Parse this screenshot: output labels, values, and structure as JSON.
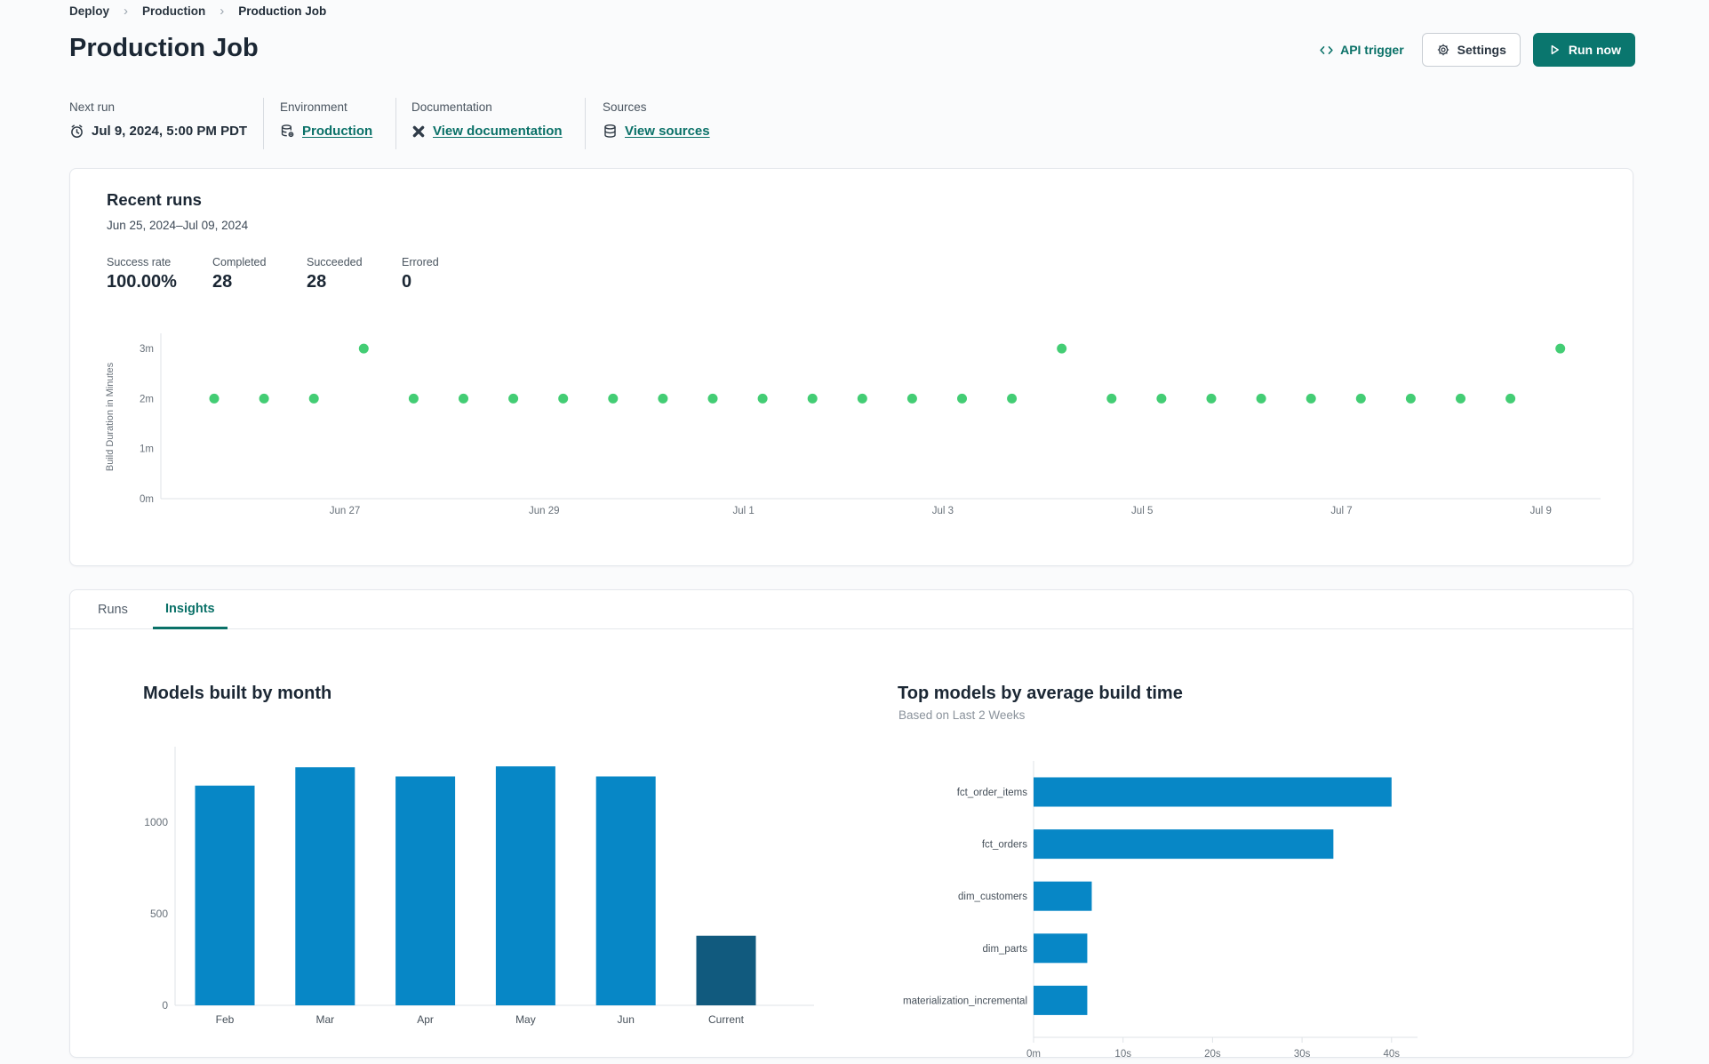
{
  "icons": {
    "breadcrumb_separator": "›"
  },
  "breadcrumb": [
    "Deploy",
    "Production",
    "Production Job"
  ],
  "header": {
    "title": "Production Job",
    "api_trigger_label": "API trigger",
    "settings_label": "Settings",
    "run_now_label": "Run now"
  },
  "meta": {
    "next_run": {
      "label": "Next run",
      "value": "Jul 9, 2024, 5:00 PM PDT"
    },
    "environment": {
      "label": "Environment",
      "link": "Production"
    },
    "documentation": {
      "label": "Documentation",
      "link": "View documentation"
    },
    "sources": {
      "label": "Sources",
      "link": "View sources"
    }
  },
  "recent_runs": {
    "title": "Recent runs",
    "date_range": "Jun 25, 2024–Jul 09, 2024",
    "stats": [
      {
        "label": "Success rate",
        "value": "100.00%"
      },
      {
        "label": "Completed",
        "value": "28"
      },
      {
        "label": "Succeeded",
        "value": "28"
      },
      {
        "label": "Errored",
        "value": "0"
      }
    ]
  },
  "tabs": [
    {
      "label": "Runs",
      "active": false
    },
    {
      "label": "Insights",
      "active": true
    }
  ],
  "colors": {
    "accent": "#0a7168",
    "run_now_bg": "#0a766e",
    "dot_green": "#43cd74",
    "bar_blue": "#0787c6",
    "bar_navy": "#115a7e",
    "axis_line": "#dfe3e7",
    "tick_text": "#68717a",
    "tick_text_dark": "#454f59"
  },
  "chart_data": [
    {
      "type": "scatter",
      "ylabel": "Build Duration in Minutes",
      "y_ticks": [
        "0m",
        "1m",
        "2m",
        "3m"
      ],
      "x_tick_labels": [
        "Jun 27",
        "Jun 29",
        "Jul 1",
        "Jul 3",
        "Jul 5",
        "Jul 7",
        "Jul 9"
      ],
      "x_range": [
        "Jun 25, 2024",
        "Jul 09, 2024"
      ],
      "ylim_minutes": [
        0,
        3.3
      ],
      "points_minutes": [
        2,
        2,
        2,
        3,
        2,
        2,
        2,
        2,
        2,
        2,
        2,
        2,
        2,
        2,
        2,
        2,
        2,
        3,
        2,
        2,
        2,
        2,
        2,
        2,
        2,
        2,
        2,
        3
      ],
      "point_color": "#43cd74",
      "grid": false,
      "legend": "none"
    },
    {
      "type": "bar",
      "title": "Models built by month",
      "categories": [
        "Feb",
        "Mar",
        "Apr",
        "May",
        "Jun",
        "Current"
      ],
      "values": [
        1200,
        1300,
        1250,
        1305,
        1250,
        380
      ],
      "bar_colors": [
        "#0787c6",
        "#0787c6",
        "#0787c6",
        "#0787c6",
        "#0787c6",
        "#115a7e"
      ],
      "y_ticks": [
        0,
        500,
        1000
      ],
      "ylim": [
        0,
        1450
      ],
      "grid": false,
      "legend": "none"
    },
    {
      "type": "bar-horizontal",
      "title": "Top models by average build time",
      "subtitle": "Based on Last 2 Weeks",
      "categories": [
        "fct_order_items",
        "fct_orders",
        "dim_customers",
        "dim_parts",
        "materialization_incremental"
      ],
      "values_seconds": [
        40,
        33.5,
        6.5,
        6,
        6
      ],
      "x_tick_labels": [
        "0m",
        "10s",
        "20s",
        "30s",
        "40s"
      ],
      "xlim_seconds": [
        0,
        43
      ],
      "bar_color": "#0787c6",
      "grid": false,
      "legend": "none"
    }
  ]
}
